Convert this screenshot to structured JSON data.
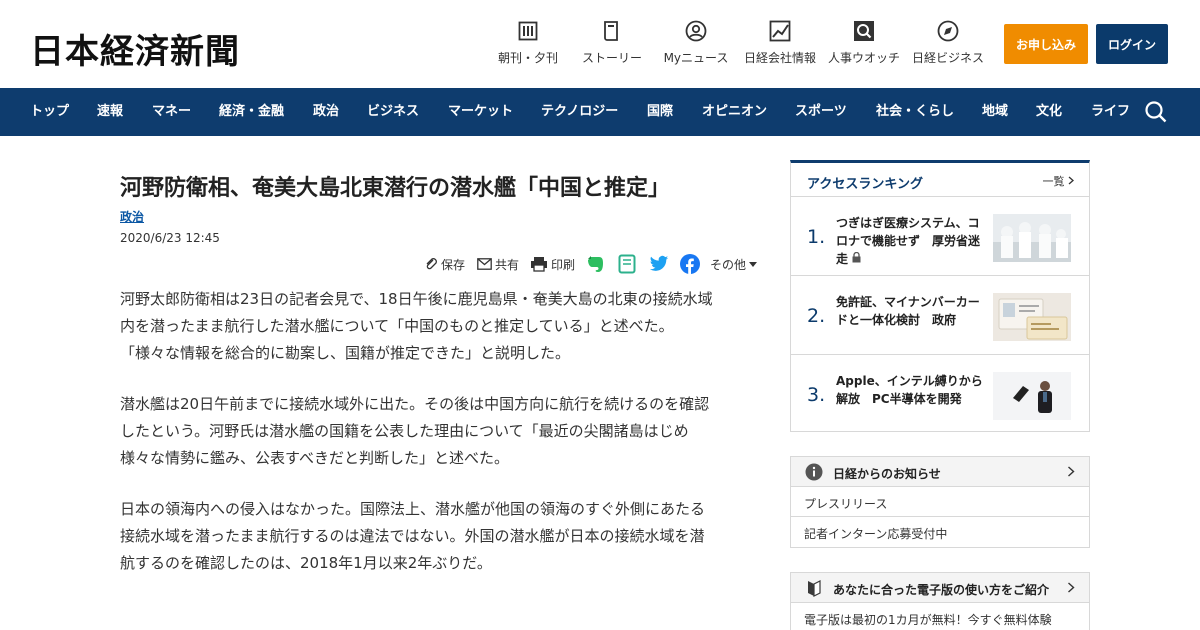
{
  "header": {
    "logo": "日本経済新聞",
    "nav": [
      {
        "label": "朝刊・夕刊",
        "icon": "newspaper-icon"
      },
      {
        "label": "ストーリー",
        "icon": "book-icon"
      },
      {
        "label": "Myニュース",
        "icon": "user-icon"
      },
      {
        "label": "日経会社情報",
        "icon": "chart-icon"
      },
      {
        "label": "人事ウオッチ",
        "icon": "magnifier-icon"
      },
      {
        "label": "日経ビジネス",
        "icon": "compass-icon"
      }
    ],
    "apply_label": "お申し込み",
    "login_label": "ログイン"
  },
  "navbar": {
    "items": [
      "トップ",
      "速報",
      "マネー",
      "経済・金融",
      "政治",
      "ビジネス",
      "マーケット",
      "テクノロジー",
      "国際",
      "オピニオン",
      "スポーツ",
      "社会・くらし",
      "地域",
      "文化",
      "ライフ"
    ]
  },
  "article": {
    "title": "河野防衛相、奄美大島北東潜行の潜水艦「中国と推定」",
    "category": "政治",
    "date": "2020/6/23 12:45",
    "share": {
      "save": "保存",
      "share": "共有",
      "print": "印刷",
      "more": "その他"
    },
    "paragraphs": [
      [
        "河野太郎防衛相は23日の記者会見で、18日午後に鹿児島県・奄美大島の北東の接続水域",
        "内を潜ったまま航行した潜水艦について「中国のものと推定している」と述べた。",
        "「様々な情報を総合的に勘案し、国籍が推定できた」と説明した。"
      ],
      [
        "潜水艦は20日午前までに接続水域外に出た。その後は中国方向に航行を続けるのを確認",
        "したという。河野氏は潜水艦の国籍を公表した理由について「最近の尖閣諸島はじめ",
        "様々な情勢に鑑み、公表すべきだと判断した」と述べた。"
      ],
      [
        "日本の領海内への侵入はなかった。国際法上、潜水艦が他国の領海のすぐ外側にあたる",
        "接続水域を潜ったまま航行するのは違法ではない。外国の潜水艦が日本の接続水域を潜",
        "航するのを確認したのは、2018年1月以来2年ぶりだ。"
      ]
    ]
  },
  "ranking": {
    "title": "アクセスランキング",
    "more": "一覧",
    "items": [
      {
        "rank": "1.",
        "text": "つぎはぎ医療システム、コロナで機能せず　厚労省迷走"
      },
      {
        "rank": "2.",
        "text": "免許証、マイナンバーカードと一体化検討　政府"
      },
      {
        "rank": "3.",
        "text": "Apple、インテル縛りから解放　PC半導体を開発"
      }
    ]
  },
  "info": {
    "title": "日経からのお知らせ",
    "items": [
      "プレスリリース",
      "記者インターン応募受付中"
    ]
  },
  "guide": {
    "title": "あなたに合った電子版の使い方をご紹介",
    "sub": "電子版は最初の1カ月が無料！今すぐ無料体験"
  }
}
